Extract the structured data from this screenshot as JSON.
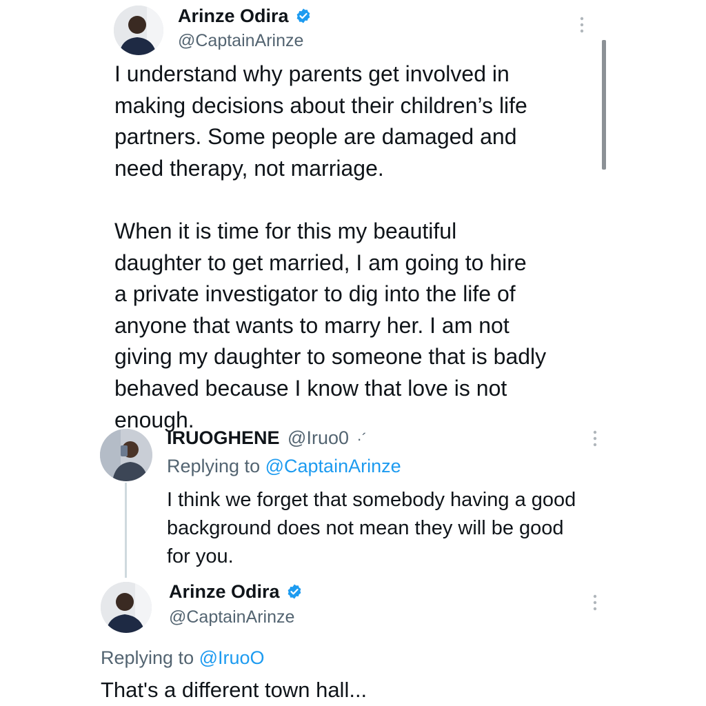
{
  "main_tweet": {
    "author_name": "Arinze Odira",
    "author_handle": "@CaptainArinze",
    "lines": [
      "I understand why parents get involved in",
      "making decisions about their children’s life",
      "partners. Some people are damaged and",
      "need therapy, not marriage.",
      "",
      "When it is time for this my beautiful",
      "daughter to get married, I am going to hire",
      "a private investigator to dig into the life of",
      "anyone that wants to marry her. I am not",
      "giving my daughter to someone that is badly",
      "behaved because I know that love is not",
      "enough."
    ]
  },
  "reply_1": {
    "author_name": "IRUOGHENE",
    "author_handle": "@Iruo0",
    "suffix": "·´",
    "replying_prefix": "Replying to",
    "replying_to": "@CaptainArinze",
    "lines": [
      "I think we forget that somebody having a good",
      "background does not mean they will be good",
      "for you."
    ]
  },
  "reply_2": {
    "author_name": "Arinze Odira",
    "author_handle": "@CaptainArinze",
    "replying_prefix": "Replying to",
    "replying_to": "@IruoO",
    "text": "That's a different town hall..."
  },
  "icons": {
    "verified": "verified-badge-icon",
    "more": "more-vertical-icon"
  },
  "colors": {
    "accent": "#1d9bf0",
    "secondary_text": "#536471",
    "primary_text": "#0f1419",
    "thread_line": "#cfd9de"
  }
}
